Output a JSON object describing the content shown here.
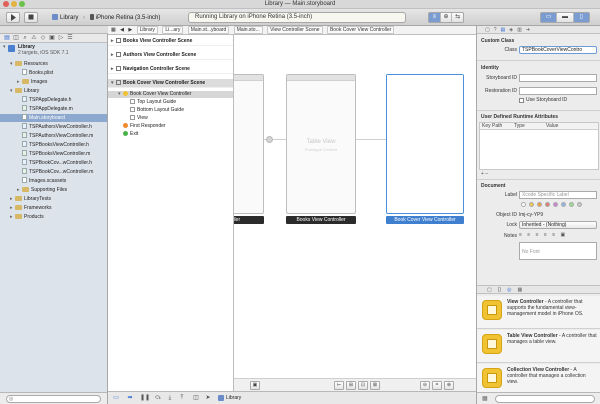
{
  "window": {
    "title": "Library — Main.storyboard"
  },
  "toolbar": {
    "run_icon": "play-icon",
    "stop_icon": "stop-icon",
    "scheme_name": "Library",
    "scheme_separator": "›",
    "device_name": "iPhone Retina (3.5-inch)",
    "activity_text": "Running Library on iPhone Retina (3.5-inch)",
    "editor_segments": [
      "≡",
      "⊕",
      "⇆"
    ],
    "view_segments": [
      "▭",
      "▬",
      "▯"
    ]
  },
  "jumpbar": {
    "crumbs": [
      "Library",
      "Li...ary",
      "Main.st...yboard",
      "Main.sto...",
      "View Controller Scene",
      "Book Cover View Controller"
    ]
  },
  "navigator": {
    "project": {
      "name": "Library",
      "subtitle": "2 targets, iOS SDK 7.1"
    },
    "items": [
      {
        "label": "Resources",
        "kind": "folder",
        "indent": 1,
        "arrow": "▾"
      },
      {
        "label": "Books.plist",
        "kind": "file",
        "indent": 2
      },
      {
        "label": "Images",
        "kind": "folder",
        "indent": 2,
        "arrow": "▸"
      },
      {
        "label": "Library",
        "kind": "folder",
        "indent": 1,
        "arrow": "▾"
      },
      {
        "label": "TSPAppDelegate.h",
        "kind": "h",
        "indent": 2
      },
      {
        "label": "TSPAppDelegate.m",
        "kind": "m",
        "indent": 2
      },
      {
        "label": "Main.storyboard",
        "kind": "file",
        "indent": 2,
        "selected": true
      },
      {
        "label": "TSPAuthorsViewController.h",
        "kind": "h",
        "indent": 2
      },
      {
        "label": "TSPAuthorsViewController.m",
        "kind": "m",
        "indent": 2
      },
      {
        "label": "TSPBooksViewController.h",
        "kind": "h",
        "indent": 2
      },
      {
        "label": "TSPBooksViewController.m",
        "kind": "m",
        "indent": 2
      },
      {
        "label": "TSPBookCov...wController.h",
        "kind": "h",
        "indent": 2
      },
      {
        "label": "TSPBookCov...wController.m",
        "kind": "m",
        "indent": 2
      },
      {
        "label": "Images.xcassets",
        "kind": "file",
        "indent": 2
      },
      {
        "label": "Supporting Files",
        "kind": "folder",
        "indent": 2,
        "arrow": "▸"
      },
      {
        "label": "LibraryTests",
        "kind": "folder",
        "indent": 1,
        "arrow": "▸"
      },
      {
        "label": "Frameworks",
        "kind": "folder",
        "indent": 1,
        "arrow": "▸"
      },
      {
        "label": "Products",
        "kind": "folder",
        "indent": 1,
        "arrow": "▸"
      }
    ]
  },
  "outline": {
    "scenes": [
      {
        "label": "Books View Controller Scene",
        "arrow": "▸"
      },
      {
        "label": "Authors View Controller Scene",
        "arrow": "▸"
      },
      {
        "label": "Navigation Controller Scene",
        "arrow": "▸"
      },
      {
        "label": "Book Cover View Controller Scene",
        "arrow": "▾"
      }
    ],
    "children": [
      {
        "label": "Book Cover View Controller",
        "indent": 1,
        "icon": "yellow",
        "arrow": "▾",
        "selected": true
      },
      {
        "label": "Top Layout Guide",
        "indent": 2,
        "icon": "box"
      },
      {
        "label": "Bottom Layout Guide",
        "indent": 2,
        "icon": "box"
      },
      {
        "label": "View",
        "indent": 2,
        "icon": "box"
      },
      {
        "label": "First Responder",
        "indent": 1,
        "icon": "orange"
      },
      {
        "label": "Exit",
        "indent": 1,
        "icon": "green"
      }
    ]
  },
  "canvas": {
    "controllers": [
      {
        "label": "...ontroller",
        "selected": false
      },
      {
        "label": "Books View Controller",
        "selected": false
      },
      {
        "label": "Book Cover View Controller",
        "selected": true
      }
    ],
    "table_view_title": "Table View",
    "table_view_subtitle": "Prototype Content"
  },
  "inspector": {
    "custom_class": {
      "title": "Custom Class",
      "class_label": "Class",
      "class_value": "TSPBookCoverViewContro"
    },
    "identity": {
      "title": "Identity",
      "storyboard_id_label": "Storyboard ID",
      "restoration_id_label": "Restoration ID",
      "use_storyboard_id_label": "Use Storyboard ID"
    },
    "runtime_attributes": {
      "title": "User Defined Runtime Attributes",
      "columns": [
        "Key Path",
        "Type",
        "Value"
      ],
      "add_remove": "+  –"
    },
    "document": {
      "title": "Document",
      "label_label": "Label",
      "label_placeholder": "Xcode Specific Label",
      "object_id_label": "Object ID",
      "object_id_value": "lmj-cy-YP9",
      "lock_label": "Lock",
      "lock_value": "Inherited - (Nothing)",
      "notes_label": "Notes",
      "font_placeholder": "No Font",
      "swatches": [
        "#ffffff",
        "#f3c74a",
        "#f2a43c",
        "#e6786f",
        "#d183d8",
        "#8fb7ec",
        "#9adf8b",
        "#c8c8c8"
      ]
    },
    "library_tabs": [
      "▢",
      "{}",
      "◎",
      "▦"
    ],
    "library_items": [
      {
        "title": "View Controller",
        "desc": "A controller that supports the fundamental view-management model in iPhone OS."
      },
      {
        "title": "Table View Controller",
        "desc": "A controller that manages a table view."
      },
      {
        "title": "Collection View Controller",
        "desc": "A controller that manages a collection view."
      }
    ]
  },
  "debugbar": {
    "scheme": "Library"
  }
}
